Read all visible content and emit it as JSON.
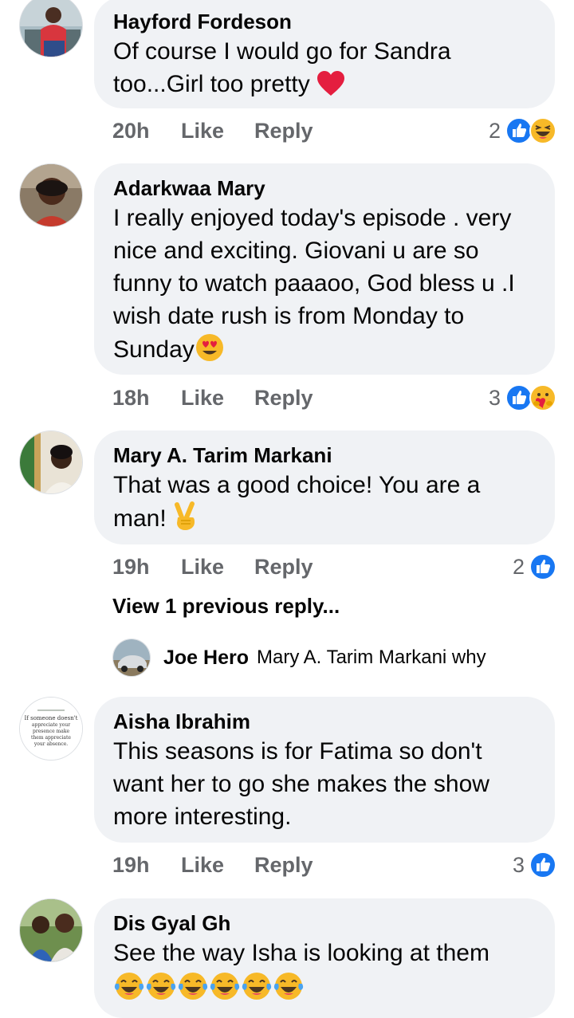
{
  "colors": {
    "bubble": "#f0f2f5",
    "meta": "#65676b",
    "like_blue": "#1877f2",
    "heart_red": "#e41e3f",
    "haha_yellow": "#f7b928"
  },
  "comments": [
    {
      "author": "Hayford Fordeson",
      "text": "Of course I would go for Sandra too...Girl too pretty",
      "emoji": "red-heart",
      "time": "20h",
      "like": "Like",
      "reply": "Reply",
      "reaction_count": "2",
      "reactions": [
        "like",
        "haha"
      ]
    },
    {
      "author": "Adarkwaa Mary",
      "text": "I really enjoyed today's episode . very nice and exciting. Giovani u are so funny to watch paaaoo, God bless u .I wish date rush is from Monday to Sunday",
      "emoji": "heart-eyes",
      "time": "18h",
      "like": "Like",
      "reply": "Reply",
      "reaction_count": "3",
      "reactions": [
        "like",
        "care"
      ]
    },
    {
      "author": "Mary A. Tarim Markani",
      "text": "That was a good choice! You are a man!",
      "emoji": "victory-hand",
      "time": "19h",
      "like": "Like",
      "reply": "Reply",
      "reaction_count": "2",
      "reactions": [
        "like"
      ]
    },
    {
      "author": "Aisha Ibrahim",
      "text": "This seasons is for Fatima so don't want her to go she makes the show more interesting.",
      "time": "19h",
      "like": "Like",
      "reply": "Reply",
      "reaction_count": "3",
      "reactions": [
        "like"
      ]
    },
    {
      "author": "Dis Gyal Gh",
      "text": "See the way Isha is looking at them",
      "emoji": "tears-of-joy x6"
    }
  ],
  "view_previous": "View 1 previous reply...",
  "nested_reply": {
    "author": "Joe Hero",
    "text": "Mary A. Tarim Markani why"
  },
  "avatar_quote": [
    "If someone doesn't",
    "appreciate your",
    "presence make",
    "them appreciate",
    "your absence."
  ]
}
